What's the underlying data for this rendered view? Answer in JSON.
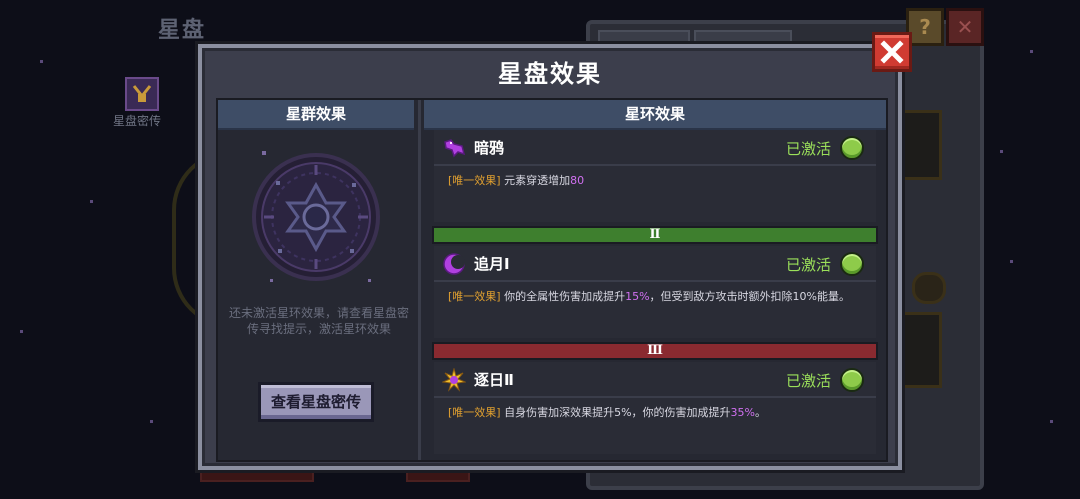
{
  "background": {
    "title": "星盘",
    "item_label": "星盘密传",
    "help_label": "?",
    "close_label": "✕"
  },
  "modal": {
    "title": "星盘效果",
    "close_icon": "close-x-icon"
  },
  "left": {
    "header": "星群效果",
    "hint": "还未激活星环效果，请查看星盘密传寻找提示，激活星环效果",
    "button_label": "查看星盘密传"
  },
  "right": {
    "header": "星环效果",
    "entries": [
      {
        "icon": "raven-icon",
        "name": "暗鸦",
        "status": "已激活",
        "tag": "[唯一效果]",
        "desc_pre": "元素穿透增加",
        "desc_hl": "80",
        "desc_post": ""
      },
      {
        "icon": "crescent-moon-icon",
        "name": "追月Ⅰ",
        "status": "已激活",
        "tag": "[唯一效果]",
        "desc_pre": "你的全属性伤害加成提升",
        "desc_hl": "15%",
        "desc_post": "，但受到敌方攻击时额外扣除10%能量。"
      },
      {
        "icon": "sun-icon",
        "name": "逐日Ⅱ",
        "status": "已激活",
        "tag": "[唯一效果]",
        "desc_pre": "自身伤害加深效果提升5%，你的伤害加成提升",
        "desc_hl": "35%",
        "desc_post": "。"
      }
    ],
    "dividers": [
      {
        "label": "Ⅱ",
        "color": "#3e7f2e"
      },
      {
        "label": "Ⅲ",
        "color": "#8a2a30"
      }
    ]
  },
  "colors": {
    "active_green": "#9be05a",
    "highlight_purple": "#d070f0",
    "tag_orange": "#e0a030",
    "close_red": "#d03b32"
  }
}
